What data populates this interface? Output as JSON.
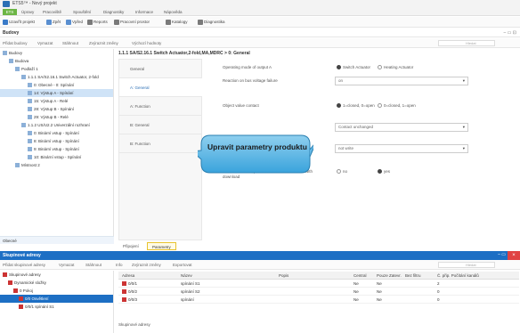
{
  "window": {
    "title": "ETS5™ - Nový projekt"
  },
  "menubar": {
    "ets_label": "ETS",
    "items": [
      "Úpravy",
      "Pracoviště",
      "Spouštění",
      "Diagnostiky",
      "Informace",
      "Nápověda"
    ]
  },
  "toolbar": {
    "items": [
      {
        "label": "Uzavřít projekt",
        "icon": "close-project-icon",
        "color": "#3a7bc8"
      },
      {
        "label": "Zpět",
        "icon": "undo-icon",
        "color": "#5a8fd0"
      },
      {
        "label": "Vpřed",
        "icon": "redo-icon",
        "color": "#5a8fd0"
      },
      {
        "label": "Reports",
        "icon": "reports-icon",
        "color": "#7a7a7a"
      },
      {
        "label": "Pracovní prostor",
        "icon": "workspace-icon",
        "color": "#7a7a7a"
      },
      {
        "label": "Katalogy",
        "icon": "catalogs-icon",
        "color": "#7a7a7a"
      },
      {
        "label": "Diagnostika",
        "icon": "diagnostics-icon",
        "color": "#7a7a7a"
      }
    ]
  },
  "budovy_panel": {
    "title": "Budovy",
    "secondary_toolbar": [
      "Přidat budovy",
      "Vymazat",
      "Stáhnout",
      "Zvýraznit změny",
      "Výchozí hodnoty"
    ],
    "search_placeholder": "Hledat"
  },
  "tree": {
    "items": [
      {
        "label": "Budovy",
        "indent": 0
      },
      {
        "label": "Budova",
        "indent": 1
      },
      {
        "label": "Podlaží 1",
        "indent": 2
      },
      {
        "label": "1.1.1 SA/S2.16.1 Switch Actuator, 2-fold",
        "indent": 3
      },
      {
        "label": "0: Obecné - 0: Spínání",
        "indent": 4
      },
      {
        "label": "14: Výstup A - Spínání",
        "indent": 4,
        "selected": true
      },
      {
        "label": "15: Výstup A - Relé",
        "indent": 4
      },
      {
        "label": "28: Výstup B - Spínání",
        "indent": 4
      },
      {
        "label": "29: Výstup B - Relé",
        "indent": 4
      },
      {
        "label": "1.1.2 US/U2.2 Univerzální rozhraní",
        "indent": 3
      },
      {
        "label": "0: Binární vstup - Spínání",
        "indent": 4
      },
      {
        "label": "8: Binární vstup - Spínání",
        "indent": 4
      },
      {
        "label": "9: Binární vstup - Spínání",
        "indent": 4
      },
      {
        "label": "10: Binární vstup - Spínání",
        "indent": 4
      },
      {
        "label": "Místnost 2",
        "indent": 2
      }
    ],
    "footer": "Obecné"
  },
  "content": {
    "breadcrumb": "1.1.1 SA/S2.16.1 Switch Actuator,2-fold,MA,MDRC > 0: General",
    "side_tabs": [
      "General",
      "A: General",
      "A: Function",
      "B: General",
      "B: Function"
    ],
    "active_tab_index": 1,
    "params": [
      {
        "label": "Operating mode of output A",
        "type": "radio",
        "options": [
          "Switch Actuator",
          "Heating Actuator"
        ],
        "selected": 0
      },
      {
        "label": "Reaction on bus voltage failure",
        "type": "dropdown",
        "value": "on"
      },
      {
        "label": "Object value contact",
        "type": "radio",
        "options": [
          "1=closed, 0=open",
          "0=closed, 1=open"
        ],
        "selected": 0
      },
      {
        "label": "",
        "type": "dropdown",
        "value": "Contact unchanged"
      },
      {
        "label": "Value object \"Switch\" on bus voltage recovery",
        "type": "dropdown",
        "value": "not write"
      },
      {
        "label": "Overwrite status, preset and threshold value 1 with download",
        "type": "radio",
        "options": [
          "no",
          "yes"
        ],
        "selected": 1
      }
    ],
    "bottom_tabs": [
      "Připojení",
      "Parametry"
    ],
    "active_bottom_tab": 1
  },
  "callout": {
    "text": "Upravit parametry produktu"
  },
  "group_panel": {
    "title": "Skupinové adresy",
    "toolbar": [
      "Přidat skupinové adresy",
      "Vymazat",
      "Stáhnout",
      "Info",
      "Zvýraznit změny",
      "Exportovat"
    ],
    "search_placeholder": "Hledat",
    "tree": [
      {
        "label": "Skupinové adresy",
        "selected": false
      },
      {
        "label": "Dynamické složky",
        "selected": false
      },
      {
        "label": "0 Pokoj",
        "selected": false
      },
      {
        "label": "0/0 Osvětlení",
        "selected": true
      },
      {
        "label": "0/0/1 spínání S1",
        "selected": false
      }
    ],
    "columns": [
      "Adresa",
      "Název",
      "Popis",
      "Central",
      "Pouze Zatevr.",
      "Bez filtru",
      "Č. přip. Počítání kanálů"
    ],
    "rows": [
      {
        "address": "0/0/1",
        "name": "spínání S1",
        "description": "",
        "central": "Ne",
        "pass": "Ne",
        "count": "2"
      },
      {
        "address": "0/0/2",
        "name": "spínání S2",
        "description": "",
        "central": "Ne",
        "pass": "Ne",
        "count": "0"
      },
      {
        "address": "0/0/3",
        "name": "spínání",
        "description": "",
        "central": "Ne",
        "pass": "Ne",
        "count": "0"
      }
    ],
    "footer": "Skupinové adresy"
  }
}
